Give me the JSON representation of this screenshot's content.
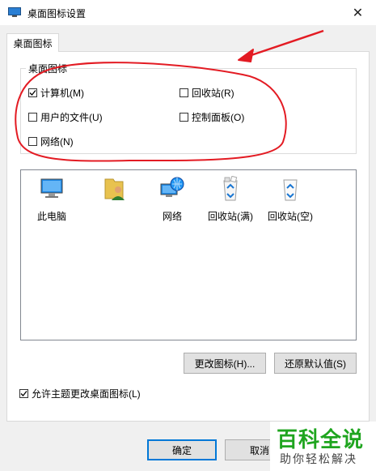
{
  "window": {
    "title": "桌面图标设置"
  },
  "tab": {
    "label": "桌面图标"
  },
  "group": {
    "label": "桌面图标",
    "checkboxes": [
      {
        "label": "计算机(M)",
        "checked": true
      },
      {
        "label": "回收站(R)",
        "checked": false
      },
      {
        "label": "用户的文件(U)",
        "checked": false
      },
      {
        "label": "控制面板(O)",
        "checked": false
      },
      {
        "label": "网络(N)",
        "checked": false
      }
    ]
  },
  "icons": [
    {
      "label": "此电脑",
      "icon": "computer-icon"
    },
    {
      "label": "",
      "icon": "user-folder-icon"
    },
    {
      "label": "网络",
      "icon": "network-icon"
    },
    {
      "label": "回收站(满)",
      "icon": "recycle-bin-full-icon"
    },
    {
      "label": "回收站(空)",
      "icon": "recycle-bin-empty-icon"
    }
  ],
  "buttons": {
    "change_icon": "更改图标(H)...",
    "restore_default": "还原默认值(S)",
    "ok": "确定",
    "cancel": "取消"
  },
  "theme_checkbox": {
    "label": "允许主题更改桌面图标(L)",
    "checked": true
  },
  "watermark": {
    "main": "百科全说",
    "sub": "助你轻松解决"
  }
}
